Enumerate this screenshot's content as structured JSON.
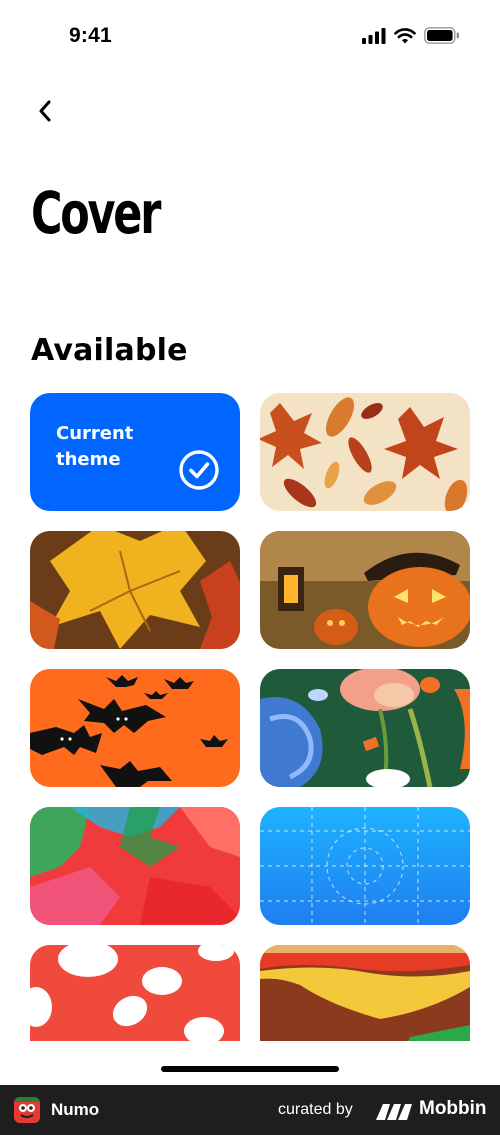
{
  "status_bar": {
    "time": "9:41",
    "icons": [
      "signal-icon",
      "wifi-icon",
      "battery-icon"
    ]
  },
  "nav": {
    "back_icon": "chevron-left-icon"
  },
  "page": {
    "title": "Cover"
  },
  "section": {
    "title": "Available"
  },
  "current_theme": {
    "label": "Current theme",
    "icon": "check-circle-icon",
    "color": "#0066FF"
  },
  "themes": [
    {
      "name": "autumn-leaves-pattern"
    },
    {
      "name": "yellow-maple-leaves"
    },
    {
      "name": "jack-o-lantern-lantern"
    },
    {
      "name": "halloween-bats"
    },
    {
      "name": "painted-flowers"
    },
    {
      "name": "watercolor-shapes"
    },
    {
      "name": "blue-grid"
    },
    {
      "name": "red-spots"
    },
    {
      "name": "striped-waves"
    }
  ],
  "footer": {
    "app_name": "Numo",
    "curated_by": "curated by",
    "brand": "Mobbin"
  }
}
